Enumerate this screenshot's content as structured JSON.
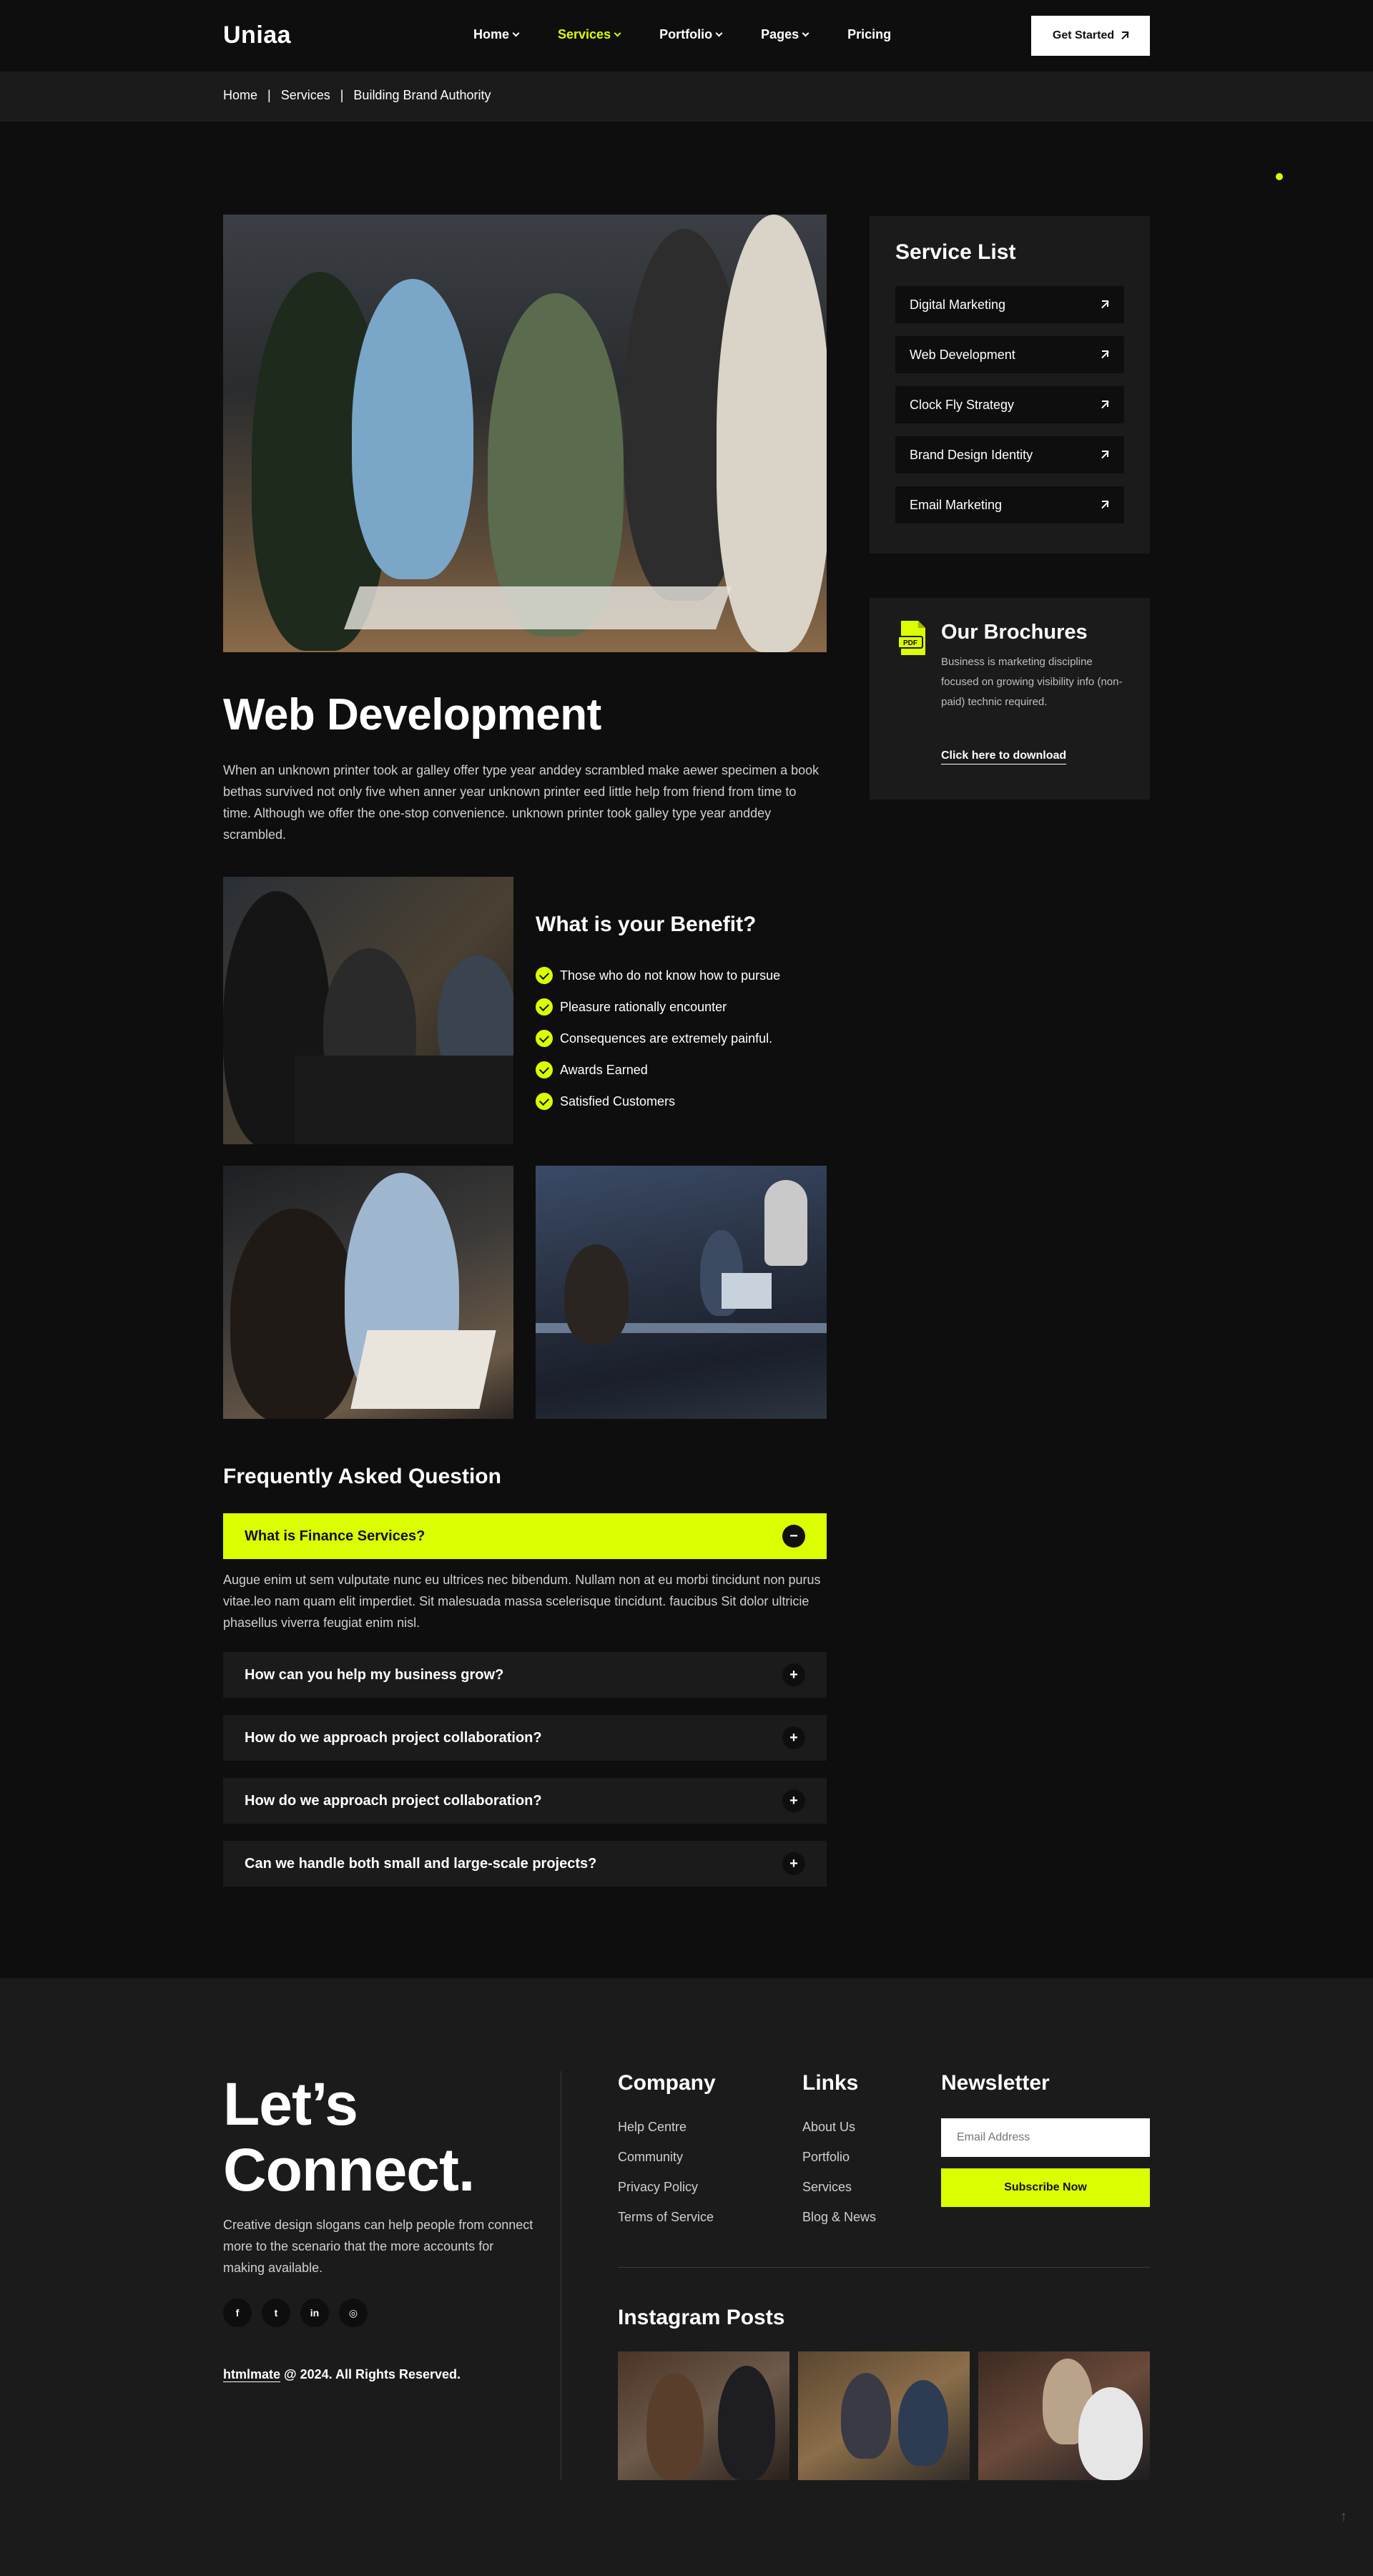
{
  "header": {
    "logo": "Uniaa",
    "nav": [
      {
        "label": "Home",
        "dropdown": true,
        "active": false
      },
      {
        "label": "Services",
        "dropdown": true,
        "active": true
      },
      {
        "label": "Portfolio",
        "dropdown": true,
        "active": false
      },
      {
        "label": "Pages",
        "dropdown": true,
        "active": false
      },
      {
        "label": "Pricing",
        "dropdown": false,
        "active": false
      }
    ],
    "cta_label": "Get Started"
  },
  "breadcrumb": [
    "Home",
    "Services",
    "Building Brand Authority"
  ],
  "main": {
    "title": "Web Development",
    "intro": "When an unknown printer took ar galley offer type year anddey scrambled make aewer specimen a book bethas survived not only five when anner year unknown printer eed little help from friend from time to time. Although we offer the one-stop convenience. unknown printer took galley type year anddey scrambled.",
    "benefit_title": "What is your Benefit?",
    "benefits": [
      "Those who do not know how to pursue",
      "Pleasure rationally encounter",
      "Consequences are extremely painful.",
      "Awards Earned",
      "Satisfied Customers"
    ]
  },
  "faq": {
    "title": "Frequently Asked Question",
    "items": [
      {
        "question": "What is Finance Services?",
        "open": true
      },
      {
        "question": "How can you help my business grow?",
        "open": false
      },
      {
        "question": "How do we approach project collaboration?",
        "open": false
      },
      {
        "question": "How do we approach project collaboration?",
        "open": false
      },
      {
        "question": "Can we handle both small and large-scale projects?",
        "open": false
      }
    ],
    "answer": "Augue enim ut sem vulputate nunc eu ultrices nec bibendum. Nullam non at eu morbi tincidunt non purus vitae.leo nam quam elit imperdiet. Sit malesuada massa scelerisque tincidunt. faucibus Sit dolor ultricie phasellus viverra feugiat enim nisl."
  },
  "sidebar": {
    "service_title": "Service List",
    "services": [
      "Digital Marketing",
      "Web Development",
      "Clock Fly Strategy",
      "Brand Design Identity",
      "Email Marketing"
    ],
    "brochure_title": "Our Brochures",
    "brochure_text": "Business is marketing discipline focused on growing visibility info (non-paid) technic required.",
    "brochure_link": "Click here to download",
    "pdf_label": "PDF"
  },
  "footer": {
    "connect_line1": "Let’s",
    "connect_line2": "Connect.",
    "description": "Creative design slogans can help people from connect more to the scenario that the more accounts for making available.",
    "socials": [
      "facebook-icon",
      "twitter-icon",
      "linkedin-icon",
      "instagram-icon"
    ],
    "social_glyphs": [
      "f",
      "t",
      "in",
      "◎"
    ],
    "copyright_brand": "htmlmate",
    "copyright_rest": " @ 2024. All Rights Reserved.",
    "company_title": "Company",
    "company_links": [
      "Help Centre",
      "Community",
      "Privacy Policy",
      "Terms of Service"
    ],
    "links_title": "Links",
    "links": [
      "About Us",
      "Portfolio",
      "Services",
      "Blog & News"
    ],
    "newsletter_title": "Newsletter",
    "email_placeholder": "Email Address",
    "subscribe_label": "Subscribe Now",
    "instagram_title": "Instagram Posts"
  },
  "colors": {
    "accent": "#dbff00",
    "background": "#0e0e0e",
    "panel": "#1b1b1b"
  }
}
